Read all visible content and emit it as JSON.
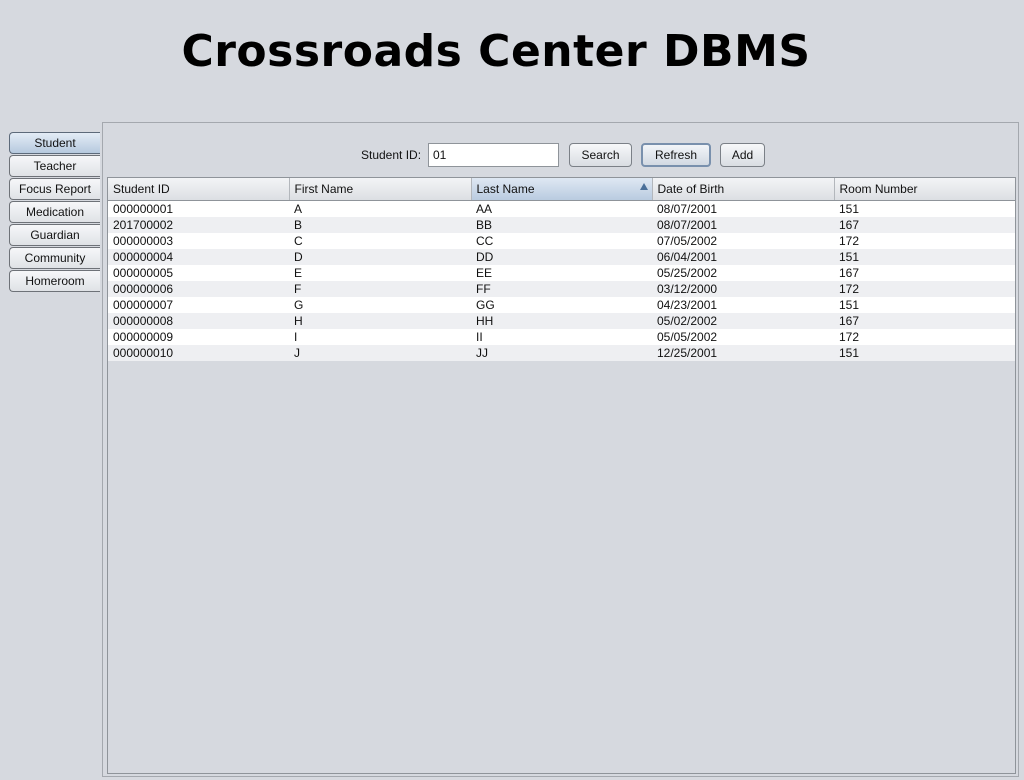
{
  "app": {
    "title": "Crossroads Center DBMS"
  },
  "tabs": [
    {
      "label": "Student",
      "active": true
    },
    {
      "label": "Teacher",
      "active": false
    },
    {
      "label": "Focus Report",
      "active": false
    },
    {
      "label": "Medication",
      "active": false
    },
    {
      "label": "Guardian",
      "active": false
    },
    {
      "label": "Community",
      "active": false
    },
    {
      "label": "Homeroom",
      "active": false
    }
  ],
  "search": {
    "label": "Student ID:",
    "value": "01",
    "search_label": "Search",
    "refresh_label": "Refresh",
    "add_label": "Add"
  },
  "table": {
    "columns": [
      "Student ID",
      "First Name",
      "Last Name",
      "Date of Birth",
      "Room Number"
    ],
    "sorted_column": "Last Name",
    "sort_direction": "ascending",
    "rows": [
      [
        "000000001",
        "A",
        "AA",
        "08/07/2001",
        "151"
      ],
      [
        "201700002",
        "B",
        "BB",
        "08/07/2001",
        "167"
      ],
      [
        "000000003",
        "C",
        "CC",
        "07/05/2002",
        "172"
      ],
      [
        "000000004",
        "D",
        "DD",
        "06/04/2001",
        "151"
      ],
      [
        "000000005",
        "E",
        "EE",
        "05/25/2002",
        "167"
      ],
      [
        "000000006",
        "F",
        "FF",
        "03/12/2000",
        "172"
      ],
      [
        "000000007",
        "G",
        "GG",
        "04/23/2001",
        "151"
      ],
      [
        "000000008",
        "H",
        "HH",
        "05/02/2002",
        "167"
      ],
      [
        "000000009",
        "I",
        "II",
        "05/05/2002",
        "172"
      ],
      [
        "000000010",
        "J",
        "JJ",
        "12/25/2001",
        "151"
      ]
    ]
  },
  "colors": {
    "background": "#d6d9df",
    "active_tab": "#b6c9de",
    "sort_indicator": "#4a6f99"
  }
}
